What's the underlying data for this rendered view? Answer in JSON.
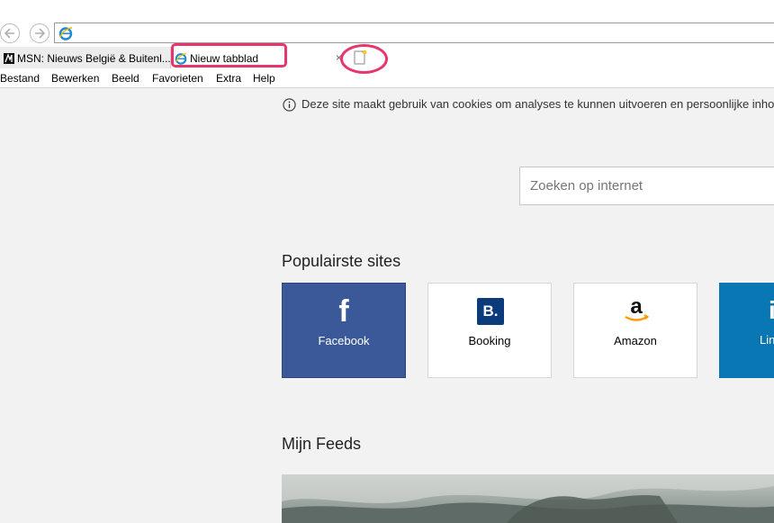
{
  "browser": {
    "nav": {
      "back_icon": "back-arrow-icon",
      "forward_icon": "forward-arrow-icon"
    },
    "address": {
      "value": "",
      "icon": "ie-logo-icon"
    },
    "tabs": [
      {
        "label": "MSN: Nieuws België & Buitenl...",
        "icon": "msn-icon"
      },
      {
        "label": "Nieuw tabblad",
        "icon": "ie-logo-icon"
      }
    ],
    "close_tab": "×",
    "menu": [
      "Bestand",
      "Bewerken",
      "Beeld",
      "Favorieten",
      "Extra",
      "Help"
    ]
  },
  "page": {
    "cookie_notice": "Deze site maakt gebruik van cookies om analyses te kunnen uitvoeren en persoonlijke inho",
    "search": {
      "placeholder": "Zoeken op internet",
      "value": ""
    },
    "popular_title": "Populairste sites",
    "tiles": [
      {
        "label": "Facebook",
        "logo": "f",
        "color": "#3b5998"
      },
      {
        "label": "Booking",
        "logo": "B.",
        "color": "#0c3b7c"
      },
      {
        "label": "Amazon",
        "logo": "a",
        "color": "#ff9900"
      },
      {
        "label": "Lin",
        "logo": "i",
        "color": "#0a77b5"
      }
    ],
    "feeds_title": "Mijn Feeds"
  },
  "annotation_color": "#e8356b"
}
